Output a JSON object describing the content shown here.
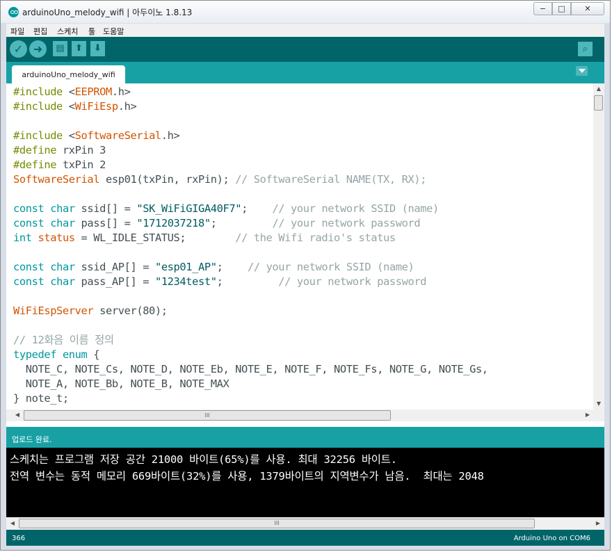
{
  "window": {
    "title": "arduinoUno_melody_wifi | 아두이노 1.8.13",
    "controls": {
      "minimize": "−",
      "maximize": "□",
      "close": "✕"
    }
  },
  "menu": [
    "파일",
    "편집",
    "스케치",
    "툴",
    "도움말"
  ],
  "toolbar": {
    "verify_icon": "✓",
    "upload_icon": "➜",
    "new_icon": "▤",
    "open_icon": "⬆",
    "save_icon": "⬇",
    "serial_monitor_icon": "⌕",
    "colors": {
      "toolbar": "#006468",
      "button": "#4db7bb",
      "tabs": "#17a1a5"
    }
  },
  "tabs": [
    {
      "label": "arduinoUno_melody_wifi",
      "active": true
    }
  ],
  "editor": {
    "lines": [
      [
        {
          "t": "#include ",
          "c": "pp"
        },
        {
          "t": "<"
        },
        {
          "t": "EEPROM",
          "c": "kw-orange"
        },
        {
          "t": ".h>"
        }
      ],
      [
        {
          "t": "#include ",
          "c": "pp"
        },
        {
          "t": "<"
        },
        {
          "t": "WiFiEsp",
          "c": "kw-orange"
        },
        {
          "t": ".h>"
        }
      ],
      [],
      [
        {
          "t": "#include ",
          "c": "pp"
        },
        {
          "t": "<"
        },
        {
          "t": "SoftwareSerial",
          "c": "kw-orange"
        },
        {
          "t": ".h>"
        }
      ],
      [
        {
          "t": "#define ",
          "c": "pp"
        },
        {
          "t": "rxPin 3"
        }
      ],
      [
        {
          "t": "#define ",
          "c": "pp"
        },
        {
          "t": "txPin 2"
        }
      ],
      [
        {
          "t": "SoftwareSerial",
          "c": "kw-orange"
        },
        {
          "t": " esp01(txPin, rxPin); "
        },
        {
          "t": "// SoftwareSerial NAME(TX, RX);",
          "c": "cmt"
        }
      ],
      [],
      [
        {
          "t": "const",
          "c": "kw-blue"
        },
        {
          "t": " "
        },
        {
          "t": "char",
          "c": "kw-blue"
        },
        {
          "t": " ssid[] = "
        },
        {
          "t": "\"SK_WiFiGIGA40F7\"",
          "c": "str"
        },
        {
          "t": ";    "
        },
        {
          "t": "// your network SSID (name)",
          "c": "cmt"
        }
      ],
      [
        {
          "t": "const",
          "c": "kw-blue"
        },
        {
          "t": " "
        },
        {
          "t": "char",
          "c": "kw-blue"
        },
        {
          "t": " pass[] = "
        },
        {
          "t": "\"1712037218\"",
          "c": "str"
        },
        {
          "t": ";         "
        },
        {
          "t": "// your network password",
          "c": "cmt"
        }
      ],
      [
        {
          "t": "int",
          "c": "kw-blue"
        },
        {
          "t": " "
        },
        {
          "t": "status",
          "c": "kw-orange"
        },
        {
          "t": " = WL_IDLE_STATUS;        "
        },
        {
          "t": "// the Wifi radio's status",
          "c": "cmt"
        }
      ],
      [],
      [
        {
          "t": "const",
          "c": "kw-blue"
        },
        {
          "t": " "
        },
        {
          "t": "char",
          "c": "kw-blue"
        },
        {
          "t": " ssid_AP[] = "
        },
        {
          "t": "\"esp01_AP\"",
          "c": "str"
        },
        {
          "t": ";    "
        },
        {
          "t": "// your network SSID (name)",
          "c": "cmt"
        }
      ],
      [
        {
          "t": "const",
          "c": "kw-blue"
        },
        {
          "t": " "
        },
        {
          "t": "char",
          "c": "kw-blue"
        },
        {
          "t": " pass_AP[] = "
        },
        {
          "t": "\"1234test\"",
          "c": "str"
        },
        {
          "t": ";         "
        },
        {
          "t": "// your network password",
          "c": "cmt"
        }
      ],
      [],
      [
        {
          "t": "WiFiEspServer",
          "c": "kw-orange"
        },
        {
          "t": " server(80);"
        }
      ],
      [],
      [
        {
          "t": "// 12화음 이름 정의",
          "c": "cmt"
        }
      ],
      [
        {
          "t": "typedef",
          "c": "kw-blue"
        },
        {
          "t": " "
        },
        {
          "t": "enum",
          "c": "kw-blue"
        },
        {
          "t": " {"
        }
      ],
      [
        {
          "t": "  NOTE_C, NOTE_Cs, NOTE_D, NOTE_Eb, NOTE_E, NOTE_F, NOTE_Fs, NOTE_G, NOTE_Gs,"
        }
      ],
      [
        {
          "t": "  NOTE_A, NOTE_Bb, NOTE_B, NOTE_MAX"
        }
      ],
      [
        {
          "t": "} note_t;"
        }
      ]
    ]
  },
  "status": {
    "message": "업로드 완료."
  },
  "console": {
    "lines": [
      "스케치는 프로그램 저장 공간 21000 바이트(65%)를 사용. 최대 32256 바이트.",
      "전역 변수는 동적 메모리 669바이트(32%)를 사용, 1379바이트의 지역변수가 남음.  최대는 2048"
    ]
  },
  "footer": {
    "line_number": "366",
    "board": "Arduino Uno on COM6"
  },
  "scroll_arrows": {
    "up": "▲",
    "down": "▼",
    "left": "◀",
    "right": "▶",
    "grip": "III"
  }
}
